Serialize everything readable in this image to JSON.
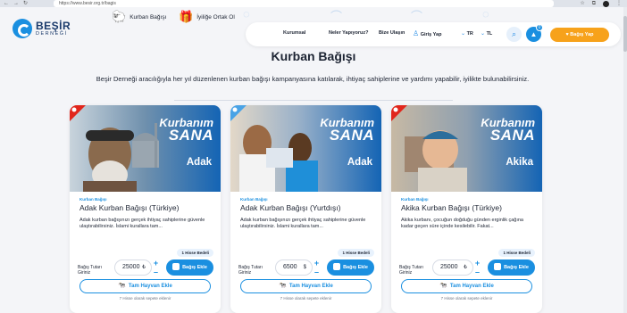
{
  "browser": {
    "url": "https://www.besir.org.tr/bagis",
    "back": "←",
    "forward": "→",
    "reload": "↻"
  },
  "logo": {
    "name": "BEŞİR",
    "sub": "DERNEĞİ"
  },
  "toplinks": {
    "kurban": "Kurban Bağışı",
    "iyilige": "İyiliğe Ortak Ol"
  },
  "nav": {
    "kurumsal": "Kurumsal",
    "neler": "Neler Yapıyoruz?",
    "bize": "Bize Ulaşın",
    "giris": "Giriş Yap",
    "lang": "TR",
    "currency": "TL",
    "cart_count": "0",
    "donate": "Bağış Yap"
  },
  "page": {
    "title": "Kurban Bağışı",
    "description": "Beşir Derneği aracılığıyla her yıl düzenlenen kurban bağışı kampanyasına katılarak, ihtiyaç sahiplerine ve yardımı yapabilir, iyilikte bulunabilirsiniz."
  },
  "cards": [
    {
      "banner_k": "Kurbanım",
      "banner_s": "SANA",
      "banner_label": "Adak",
      "category": "Kurban Bağışı",
      "title": "Adak Kurban Bağışı (Türkiye)",
      "description": "Adak kurban bağışınızı gerçek ihtiyaç sahiplerine güvenle ulaştırabilirsiniz. İslami kurallara tam...",
      "pill": "1 Hisse Bedeli",
      "amount_label": "Bağış Tutarı Giriniz",
      "amount": "25000",
      "currency": "₺",
      "add": "Bağış Ekle",
      "full": "Tam Hayvan Ekle",
      "note": "7 Hisse olarak sepete eklenir"
    },
    {
      "banner_k": "Kurbanım",
      "banner_s": "SANA",
      "banner_label": "Adak",
      "category": "Kurban Bağışı",
      "title": "Adak Kurban Bağışı (Yurtdışı)",
      "description": "Adak kurban bağışınızı gerçek ihtiyaç sahiplerine güvenle ulaştırabilirsiniz. İslami kurallara tam...",
      "pill": "1 Hisse Bedeli",
      "amount_label": "Bağış Tutarı Giriniz",
      "amount": "6500",
      "currency": "$",
      "add": "Bağış Ekle",
      "full": "Tam Hayvan Ekle",
      "note": "7 Hisse olarak sepete eklenir"
    },
    {
      "banner_k": "Kurbanım",
      "banner_s": "SANA",
      "banner_label": "Akika",
      "category": "Kurban Bağışı",
      "title": "Akika Kurban Bağışı (Türkiye)",
      "description": "Akika kurbanı, çocuğun doğduğu günden erginlik çağına kadar geçen süre içinde kesilebilir. Fakat...",
      "pill": "1 Hisse Bedeli",
      "amount_label": "Bağış Tutarı Giriniz",
      "amount": "25000",
      "currency": "₺",
      "add": "Bağış Ekle",
      "full": "Tam Hayvan Ekle",
      "note": "7 Hisse olarak sepete eklenir"
    }
  ],
  "colors": {
    "brand_blue": "#1a8fe0",
    "donate_orange": "#f7a21b",
    "navy": "#1d2433"
  },
  "icons": {
    "kurban": "sheep-icon",
    "iyilige": "gift-icon",
    "user": "user-icon",
    "search": "search-icon",
    "cart": "bag-icon"
  }
}
